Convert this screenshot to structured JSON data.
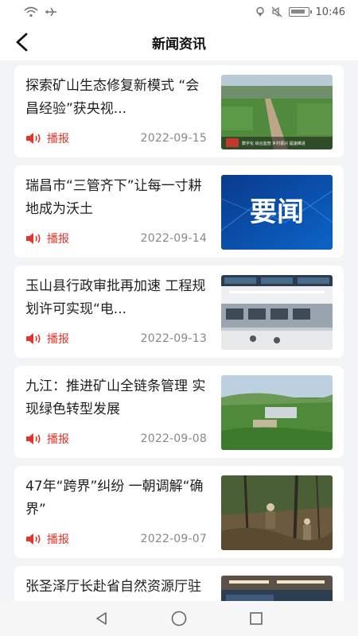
{
  "status_bar": {
    "time": "10:46"
  },
  "header": {
    "title": "新闻资讯"
  },
  "bobao_label": "播报",
  "thumb1_caption": "数字化 综合监管 乡村振兴 提速推进",
  "thumb2_text": "要闻",
  "news": [
    {
      "title": "探索矿山生态修复新模式 “会昌经验”获央视...",
      "date": "2022-09-15"
    },
    {
      "title": "瑞昌市“三管齐下”让每一寸耕地成为沃土",
      "date": "2022-09-14"
    },
    {
      "title": "玉山县行政审批再加速 工程规划许可实现“电...",
      "date": "2022-09-13"
    },
    {
      "title": "九江：推进矿山全链条管理 实现绿色转型发展",
      "date": "2022-09-08"
    },
    {
      "title": "47年“跨界”纠纷 一朝调解“确界”",
      "date": "2022-09-07"
    },
    {
      "title": "张圣泽厅长赴省自然资源厅驻省政务服务中",
      "date": ""
    }
  ]
}
